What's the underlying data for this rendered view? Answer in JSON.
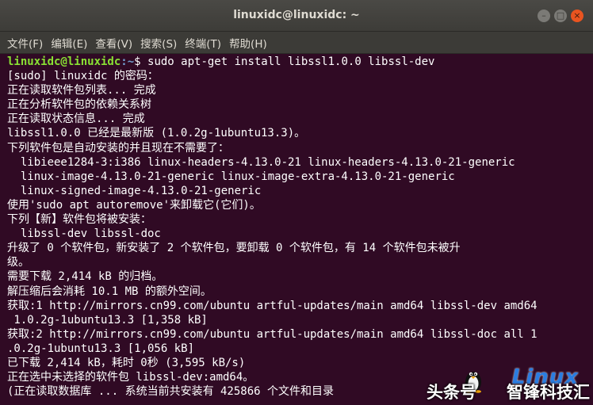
{
  "window": {
    "title": "linuxidc@linuxidc: ~",
    "buttons": {
      "minimize": "–",
      "maximize": "□",
      "close": "×"
    }
  },
  "menubar": {
    "items": [
      "文件(F)",
      "编辑(E)",
      "查看(V)",
      "搜索(S)",
      "终端(T)",
      "帮助(H)"
    ]
  },
  "terminal": {
    "prompt": {
      "user_host": "linuxidc@linuxidc",
      "path": ":~",
      "symbol": "$"
    },
    "command": " sudo apt-get install libssl1.0.0 libssl-dev",
    "lines": [
      "[sudo] linuxidc 的密码：",
      "正在读取软件包列表... 完成",
      "正在分析软件包的依赖关系树",
      "正在读取状态信息... 完成",
      "libssl1.0.0 已经是最新版 (1.0.2g-1ubuntu13.3)。",
      "下列软件包是自动安装的并且现在不需要了：",
      "  libieee1284-3:i386 linux-headers-4.13.0-21 linux-headers-4.13.0-21-generic",
      "  linux-image-4.13.0-21-generic linux-image-extra-4.13.0-21-generic",
      "  linux-signed-image-4.13.0-21-generic",
      "使用'sudo apt autoremove'来卸载它(它们)。",
      "下列【新】软件包将被安装：",
      "  libssl-dev libssl-doc",
      "升级了 0 个软件包，新安装了 2 个软件包，要卸载 0 个软件包，有 14 个软件包未被升",
      "级。",
      "需要下载 2,414 kB 的归档。",
      "解压缩后会消耗 10.1 MB 的额外空间。",
      "获取:1 http://mirrors.cn99.com/ubuntu artful-updates/main amd64 libssl-dev amd64",
      " 1.0.2g-1ubuntu13.3 [1,358 kB]",
      "获取:2 http://mirrors.cn99.com/ubuntu artful-updates/main amd64 libssl-doc all 1",
      ".0.2g-1ubuntu13.3 [1,056 kB]",
      "已下载 2,414 kB，耗时 0秒 (3,595 kB/s)",
      "正在选中未选择的软件包 libssl-dev:amd64。",
      "(正在读取数据库 ... 系统当前共安装有 425866 个文件和目录"
    ]
  },
  "watermark": {
    "left_text": "头条号",
    "right_text": "智锋科技汇",
    "linux_text": "Linux"
  },
  "colors": {
    "terminal_bg": "#300a24",
    "prompt_user": "#8ae234",
    "prompt_path": "#729fcf",
    "close_button": "#e95420"
  }
}
